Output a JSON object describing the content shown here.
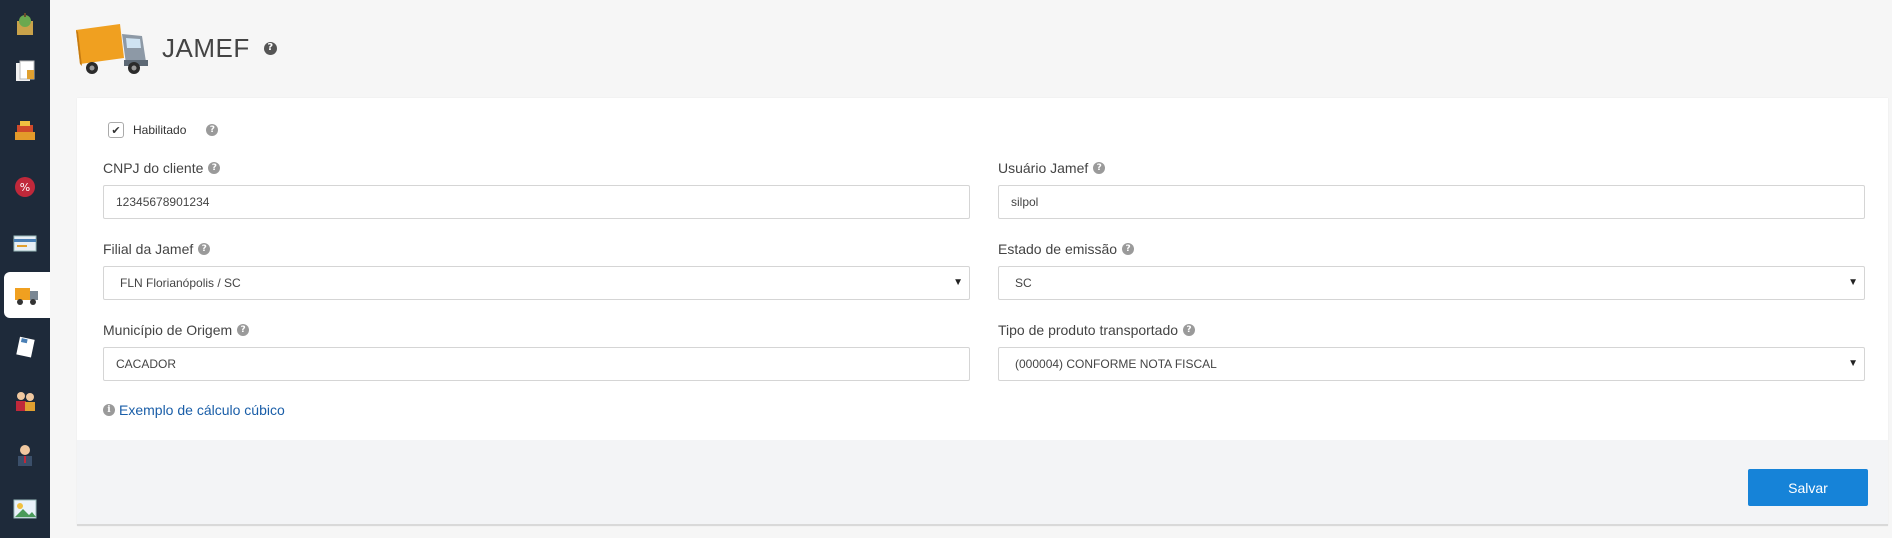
{
  "header": {
    "title": "JAMEF",
    "help_glyph": "?"
  },
  "form": {
    "enabled": {
      "label": "Habilitado",
      "checked": true,
      "check_glyph": "✔",
      "help_glyph": "?"
    },
    "cnpj": {
      "label": "CNPJ do cliente",
      "value": "12345678901234"
    },
    "usuario": {
      "label": "Usuário Jamef",
      "value": "silpol"
    },
    "filial": {
      "label": "Filial da Jamef",
      "value": "FLN Florianópolis / SC"
    },
    "estado": {
      "label": "Estado de emissão",
      "value": "SC"
    },
    "municipio": {
      "label": "Município de Origem",
      "value": "CACADOR"
    },
    "tipo_produto": {
      "label": "Tipo de produto transportado",
      "value": "(000004) CONFORME NOTA FISCAL"
    },
    "help_glyph": "?",
    "caret_glyph": "▼"
  },
  "example_link": {
    "label": "Exemplo de cálculo cúbico",
    "info_glyph": "i"
  },
  "footer": {
    "save_label": "Salvar"
  },
  "sidebar": {
    "icons": [
      "apple-box-icon",
      "documents-icon",
      "stacked-boxes-icon",
      "discount-icon",
      "card-icon",
      "truck-icon",
      "note-icon",
      "users-icon",
      "person-icon",
      "picture-icon"
    ],
    "active": "truck-icon"
  },
  "colors": {
    "sidebar": "#1e2a3a",
    "accent": "#1683d8",
    "link": "#1a5ea8"
  }
}
